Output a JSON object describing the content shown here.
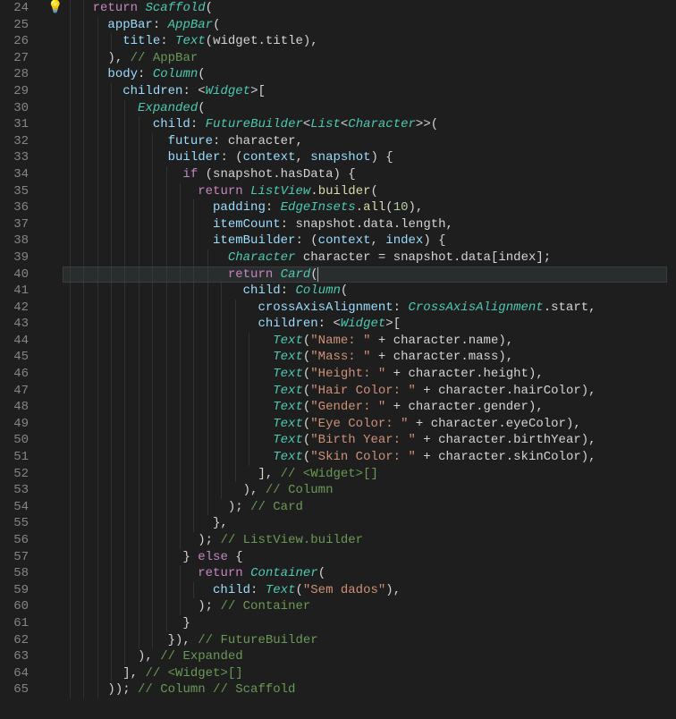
{
  "startLine": 24,
  "highlightedLineIndex": 16,
  "lightbulbLineIndex": 16,
  "lines": [
    {
      "indent": 4,
      "tokens": [
        {
          "t": "kw",
          "v": "return"
        },
        {
          "t": "pun",
          "v": " "
        },
        {
          "t": "cls",
          "v": "Scaffold"
        },
        {
          "t": "pun",
          "v": "("
        }
      ]
    },
    {
      "indent": 6,
      "tokens": [
        {
          "t": "prop",
          "v": "appBar"
        },
        {
          "t": "pun",
          "v": ": "
        },
        {
          "t": "cls",
          "v": "AppBar"
        },
        {
          "t": "pun",
          "v": "("
        }
      ]
    },
    {
      "indent": 8,
      "tokens": [
        {
          "t": "prop",
          "v": "title"
        },
        {
          "t": "pun",
          "v": ": "
        },
        {
          "t": "cls",
          "v": "Text"
        },
        {
          "t": "pun",
          "v": "("
        },
        {
          "t": "var",
          "v": "widget"
        },
        {
          "t": "pun",
          "v": "."
        },
        {
          "t": "var",
          "v": "title"
        },
        {
          "t": "pun",
          "v": "),"
        }
      ]
    },
    {
      "indent": 6,
      "tokens": [
        {
          "t": "pun",
          "v": "), "
        },
        {
          "t": "cmt",
          "v": "// AppBar"
        }
      ]
    },
    {
      "indent": 6,
      "tokens": [
        {
          "t": "prop",
          "v": "body"
        },
        {
          "t": "pun",
          "v": ": "
        },
        {
          "t": "cls",
          "v": "Column"
        },
        {
          "t": "pun",
          "v": "("
        }
      ]
    },
    {
      "indent": 8,
      "tokens": [
        {
          "t": "prop",
          "v": "children"
        },
        {
          "t": "pun",
          "v": ": <"
        },
        {
          "t": "cls",
          "v": "Widget"
        },
        {
          "t": "pun",
          "v": ">["
        }
      ]
    },
    {
      "indent": 10,
      "tokens": [
        {
          "t": "cls",
          "v": "Expanded"
        },
        {
          "t": "pun",
          "v": "("
        }
      ]
    },
    {
      "indent": 12,
      "tokens": [
        {
          "t": "prop",
          "v": "child"
        },
        {
          "t": "pun",
          "v": ": "
        },
        {
          "t": "cls",
          "v": "FutureBuilder"
        },
        {
          "t": "pun",
          "v": "<"
        },
        {
          "t": "cls",
          "v": "List"
        },
        {
          "t": "pun",
          "v": "<"
        },
        {
          "t": "cls",
          "v": "Character"
        },
        {
          "t": "pun",
          "v": ">>("
        }
      ]
    },
    {
      "indent": 14,
      "tokens": [
        {
          "t": "prop",
          "v": "future"
        },
        {
          "t": "pun",
          "v": ": "
        },
        {
          "t": "var",
          "v": "character"
        },
        {
          "t": "pun",
          "v": ","
        }
      ]
    },
    {
      "indent": 14,
      "tokens": [
        {
          "t": "prop",
          "v": "builder"
        },
        {
          "t": "pun",
          "v": ": ("
        },
        {
          "t": "par",
          "v": "context"
        },
        {
          "t": "pun",
          "v": ", "
        },
        {
          "t": "par",
          "v": "snapshot"
        },
        {
          "t": "pun",
          "v": ") {"
        }
      ]
    },
    {
      "indent": 16,
      "tokens": [
        {
          "t": "kw",
          "v": "if"
        },
        {
          "t": "pun",
          "v": " ("
        },
        {
          "t": "var",
          "v": "snapshot"
        },
        {
          "t": "pun",
          "v": "."
        },
        {
          "t": "var",
          "v": "hasData"
        },
        {
          "t": "pun",
          "v": ") {"
        }
      ]
    },
    {
      "indent": 18,
      "tokens": [
        {
          "t": "kw",
          "v": "return"
        },
        {
          "t": "pun",
          "v": " "
        },
        {
          "t": "cls",
          "v": "ListView"
        },
        {
          "t": "pun",
          "v": "."
        },
        {
          "t": "fn",
          "v": "builder"
        },
        {
          "t": "pun",
          "v": "("
        }
      ]
    },
    {
      "indent": 20,
      "tokens": [
        {
          "t": "prop",
          "v": "padding"
        },
        {
          "t": "pun",
          "v": ": "
        },
        {
          "t": "cls",
          "v": "EdgeInsets"
        },
        {
          "t": "pun",
          "v": "."
        },
        {
          "t": "fn",
          "v": "all"
        },
        {
          "t": "pun",
          "v": "("
        },
        {
          "t": "num",
          "v": "10"
        },
        {
          "t": "pun",
          "v": "),"
        }
      ]
    },
    {
      "indent": 20,
      "tokens": [
        {
          "t": "prop",
          "v": "itemCount"
        },
        {
          "t": "pun",
          "v": ": "
        },
        {
          "t": "var",
          "v": "snapshot"
        },
        {
          "t": "pun",
          "v": "."
        },
        {
          "t": "var",
          "v": "data"
        },
        {
          "t": "pun",
          "v": "."
        },
        {
          "t": "var",
          "v": "length"
        },
        {
          "t": "pun",
          "v": ","
        }
      ]
    },
    {
      "indent": 20,
      "tokens": [
        {
          "t": "prop",
          "v": "itemBuilder"
        },
        {
          "t": "pun",
          "v": ": ("
        },
        {
          "t": "par",
          "v": "context"
        },
        {
          "t": "pun",
          "v": ", "
        },
        {
          "t": "par",
          "v": "index"
        },
        {
          "t": "pun",
          "v": ") {"
        }
      ]
    },
    {
      "indent": 22,
      "tokens": [
        {
          "t": "cls",
          "v": "Character"
        },
        {
          "t": "pun",
          "v": " "
        },
        {
          "t": "var",
          "v": "character"
        },
        {
          "t": "pun",
          "v": " = "
        },
        {
          "t": "var",
          "v": "snapshot"
        },
        {
          "t": "pun",
          "v": "."
        },
        {
          "t": "var",
          "v": "data"
        },
        {
          "t": "pun",
          "v": "["
        },
        {
          "t": "var",
          "v": "index"
        },
        {
          "t": "pun",
          "v": "];"
        }
      ]
    },
    {
      "indent": 22,
      "tokens": [
        {
          "t": "kw",
          "v": "return"
        },
        {
          "t": "pun",
          "v": " "
        },
        {
          "t": "cls",
          "v": "Card"
        },
        {
          "t": "pun",
          "v": "("
        },
        {
          "t": "cursor",
          "v": ""
        }
      ]
    },
    {
      "indent": 24,
      "tokens": [
        {
          "t": "prop",
          "v": "child"
        },
        {
          "t": "pun",
          "v": ": "
        },
        {
          "t": "cls",
          "v": "Column"
        },
        {
          "t": "pun",
          "v": "("
        }
      ]
    },
    {
      "indent": 26,
      "tokens": [
        {
          "t": "prop",
          "v": "crossAxisAlignment"
        },
        {
          "t": "pun",
          "v": ": "
        },
        {
          "t": "cls",
          "v": "CrossAxisAlignment"
        },
        {
          "t": "pun",
          "v": "."
        },
        {
          "t": "var",
          "v": "start"
        },
        {
          "t": "pun",
          "v": ","
        }
      ]
    },
    {
      "indent": 26,
      "tokens": [
        {
          "t": "prop",
          "v": "children"
        },
        {
          "t": "pun",
          "v": ": <"
        },
        {
          "t": "cls",
          "v": "Widget"
        },
        {
          "t": "pun",
          "v": ">["
        }
      ]
    },
    {
      "indent": 28,
      "tokens": [
        {
          "t": "cls",
          "v": "Text"
        },
        {
          "t": "pun",
          "v": "("
        },
        {
          "t": "str",
          "v": "\"Name: \""
        },
        {
          "t": "pun",
          "v": " + "
        },
        {
          "t": "var",
          "v": "character"
        },
        {
          "t": "pun",
          "v": "."
        },
        {
          "t": "var",
          "v": "name"
        },
        {
          "t": "pun",
          "v": "),"
        }
      ]
    },
    {
      "indent": 28,
      "tokens": [
        {
          "t": "cls",
          "v": "Text"
        },
        {
          "t": "pun",
          "v": "("
        },
        {
          "t": "str",
          "v": "\"Mass: \""
        },
        {
          "t": "pun",
          "v": " + "
        },
        {
          "t": "var",
          "v": "character"
        },
        {
          "t": "pun",
          "v": "."
        },
        {
          "t": "var",
          "v": "mass"
        },
        {
          "t": "pun",
          "v": "),"
        }
      ]
    },
    {
      "indent": 28,
      "tokens": [
        {
          "t": "cls",
          "v": "Text"
        },
        {
          "t": "pun",
          "v": "("
        },
        {
          "t": "str",
          "v": "\"Height: \""
        },
        {
          "t": "pun",
          "v": " + "
        },
        {
          "t": "var",
          "v": "character"
        },
        {
          "t": "pun",
          "v": "."
        },
        {
          "t": "var",
          "v": "height"
        },
        {
          "t": "pun",
          "v": "),"
        }
      ]
    },
    {
      "indent": 28,
      "tokens": [
        {
          "t": "cls",
          "v": "Text"
        },
        {
          "t": "pun",
          "v": "("
        },
        {
          "t": "str",
          "v": "\"Hair Color: \""
        },
        {
          "t": "pun",
          "v": " + "
        },
        {
          "t": "var",
          "v": "character"
        },
        {
          "t": "pun",
          "v": "."
        },
        {
          "t": "var",
          "v": "hairColor"
        },
        {
          "t": "pun",
          "v": "),"
        }
      ]
    },
    {
      "indent": 28,
      "tokens": [
        {
          "t": "cls",
          "v": "Text"
        },
        {
          "t": "pun",
          "v": "("
        },
        {
          "t": "str",
          "v": "\"Gender: \""
        },
        {
          "t": "pun",
          "v": " + "
        },
        {
          "t": "var",
          "v": "character"
        },
        {
          "t": "pun",
          "v": "."
        },
        {
          "t": "var",
          "v": "gender"
        },
        {
          "t": "pun",
          "v": "),"
        }
      ]
    },
    {
      "indent": 28,
      "tokens": [
        {
          "t": "cls",
          "v": "Text"
        },
        {
          "t": "pun",
          "v": "("
        },
        {
          "t": "str",
          "v": "\"Eye Color: \""
        },
        {
          "t": "pun",
          "v": " + "
        },
        {
          "t": "var",
          "v": "character"
        },
        {
          "t": "pun",
          "v": "."
        },
        {
          "t": "var",
          "v": "eyeColor"
        },
        {
          "t": "pun",
          "v": "),"
        }
      ]
    },
    {
      "indent": 28,
      "tokens": [
        {
          "t": "cls",
          "v": "Text"
        },
        {
          "t": "pun",
          "v": "("
        },
        {
          "t": "str",
          "v": "\"Birth Year: \""
        },
        {
          "t": "pun",
          "v": " + "
        },
        {
          "t": "var",
          "v": "character"
        },
        {
          "t": "pun",
          "v": "."
        },
        {
          "t": "var",
          "v": "birthYear"
        },
        {
          "t": "pun",
          "v": "),"
        }
      ]
    },
    {
      "indent": 28,
      "tokens": [
        {
          "t": "cls",
          "v": "Text"
        },
        {
          "t": "pun",
          "v": "("
        },
        {
          "t": "str",
          "v": "\"Skin Color: \""
        },
        {
          "t": "pun",
          "v": " + "
        },
        {
          "t": "var",
          "v": "character"
        },
        {
          "t": "pun",
          "v": "."
        },
        {
          "t": "var",
          "v": "skinColor"
        },
        {
          "t": "pun",
          "v": "),"
        }
      ]
    },
    {
      "indent": 26,
      "tokens": [
        {
          "t": "pun",
          "v": "], "
        },
        {
          "t": "cmt",
          "v": "// <Widget>[]"
        }
      ]
    },
    {
      "indent": 24,
      "tokens": [
        {
          "t": "pun",
          "v": "), "
        },
        {
          "t": "cmt",
          "v": "// Column"
        }
      ]
    },
    {
      "indent": 22,
      "tokens": [
        {
          "t": "pun",
          "v": "); "
        },
        {
          "t": "cmt",
          "v": "// Card"
        }
      ]
    },
    {
      "indent": 20,
      "tokens": [
        {
          "t": "pun",
          "v": "},"
        }
      ]
    },
    {
      "indent": 18,
      "tokens": [
        {
          "t": "pun",
          "v": "); "
        },
        {
          "t": "cmt",
          "v": "// ListView.builder"
        }
      ]
    },
    {
      "indent": 16,
      "tokens": [
        {
          "t": "pun",
          "v": "} "
        },
        {
          "t": "kw",
          "v": "else"
        },
        {
          "t": "pun",
          "v": " {"
        }
      ]
    },
    {
      "indent": 18,
      "tokens": [
        {
          "t": "kw",
          "v": "return"
        },
        {
          "t": "pun",
          "v": " "
        },
        {
          "t": "cls",
          "v": "Container"
        },
        {
          "t": "pun",
          "v": "("
        }
      ]
    },
    {
      "indent": 20,
      "tokens": [
        {
          "t": "prop",
          "v": "child"
        },
        {
          "t": "pun",
          "v": ": "
        },
        {
          "t": "cls",
          "v": "Text"
        },
        {
          "t": "pun",
          "v": "("
        },
        {
          "t": "str",
          "v": "\"Sem dados\""
        },
        {
          "t": "pun",
          "v": "),"
        }
      ]
    },
    {
      "indent": 18,
      "tokens": [
        {
          "t": "pun",
          "v": "); "
        },
        {
          "t": "cmt",
          "v": "// Container"
        }
      ]
    },
    {
      "indent": 16,
      "tokens": [
        {
          "t": "pun",
          "v": "}"
        }
      ]
    },
    {
      "indent": 14,
      "tokens": [
        {
          "t": "pun",
          "v": "}), "
        },
        {
          "t": "cmt",
          "v": "// FutureBuilder"
        }
      ]
    },
    {
      "indent": 10,
      "tokens": [
        {
          "t": "pun",
          "v": "), "
        },
        {
          "t": "cmt",
          "v": "// Expanded"
        }
      ]
    },
    {
      "indent": 8,
      "tokens": [
        {
          "t": "pun",
          "v": "], "
        },
        {
          "t": "cmt",
          "v": "// <Widget>[]"
        }
      ]
    },
    {
      "indent": 6,
      "tokens": [
        {
          "t": "pun",
          "v": ")); "
        },
        {
          "t": "cmt",
          "v": "// Column // Scaffold"
        }
      ]
    }
  ]
}
